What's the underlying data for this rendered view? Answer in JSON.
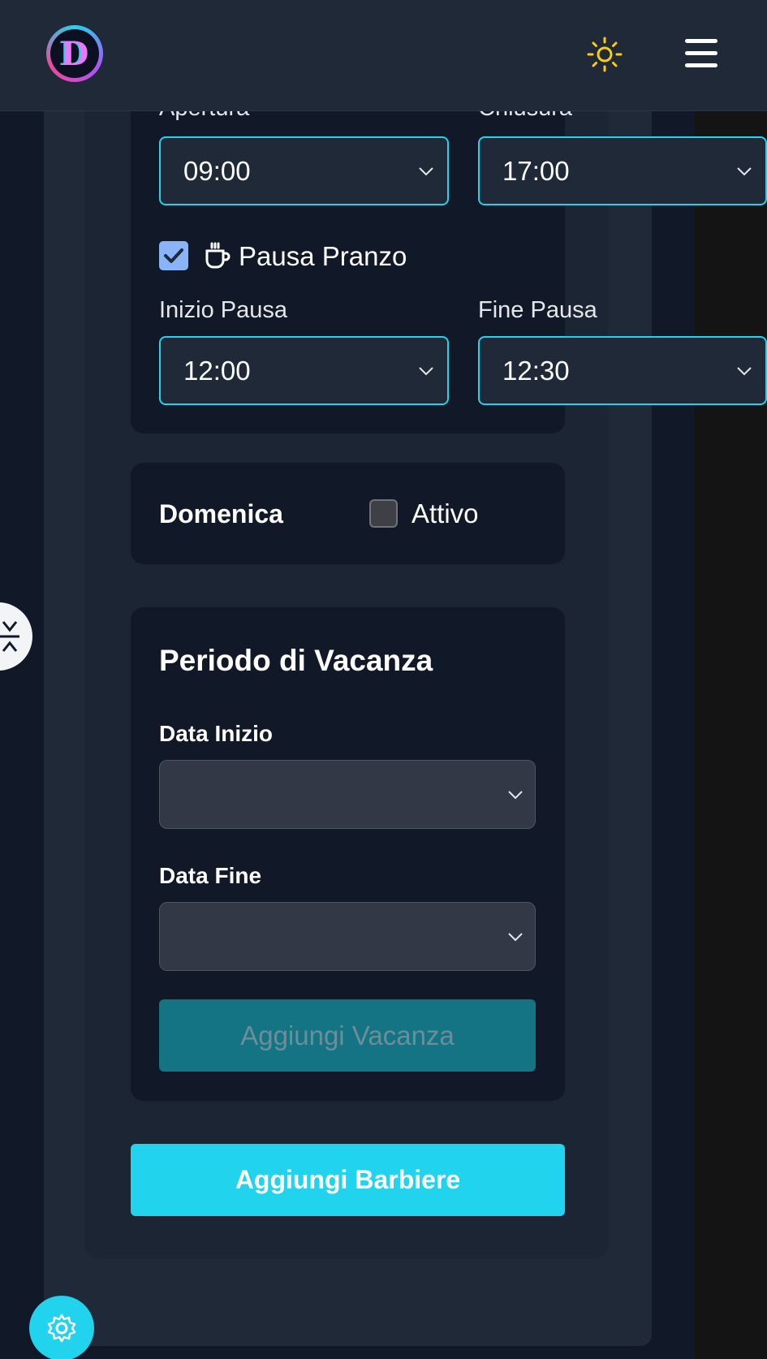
{
  "header": {
    "logo_text": "D",
    "theme_toggle_icon": "sun-icon",
    "menu_icon": "hamburger-menu-icon"
  },
  "hours": {
    "open_label": "Apertura",
    "close_label": "Chiusura",
    "open_value": "09:00",
    "close_value": "17:00",
    "lunch_break_checked": true,
    "lunch_break_icon": "coffee-cup-icon",
    "lunch_break_label": "Pausa Pranzo",
    "break_start_label": "Inizio Pausa",
    "break_end_label": "Fine Pausa",
    "break_start_value": "12:00",
    "break_end_value": "12:30"
  },
  "sunday": {
    "day_label": "Domenica",
    "active_label": "Attivo",
    "active_checked": false
  },
  "vacation": {
    "title": "Periodo di Vacanza",
    "start_label": "Data Inizio",
    "start_value": "",
    "end_label": "Data Fine",
    "end_value": "",
    "add_button": "Aggiungi Vacanza"
  },
  "submit_button": "Aggiungi Barbiere",
  "floating": {
    "side_handle_icon": "collapse-arrows-icon",
    "settings_icon": "gear-icon"
  },
  "colors": {
    "accent": "#22d3ee",
    "background": "#111827",
    "panel": "#1f2937",
    "checkbox_checked": "#8ab4f8",
    "sun": "#facc15"
  }
}
